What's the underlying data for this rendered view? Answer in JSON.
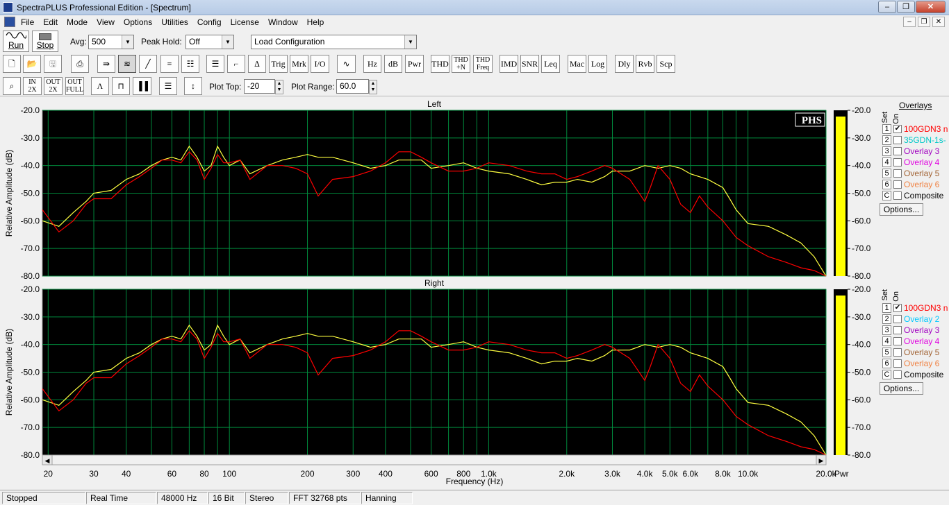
{
  "window": {
    "title": "SpectraPLUS Professional Edition - [Spectrum]"
  },
  "menu": [
    "File",
    "Edit",
    "Mode",
    "View",
    "Options",
    "Utilities",
    "Config",
    "License",
    "Window",
    "Help"
  ],
  "toolbar1": {
    "run_label": "Run",
    "stop_label": "Stop",
    "avg_label": "Avg:",
    "avg_value": "500",
    "peak_hold_label": "Peak Hold:",
    "peak_hold_value": "Off",
    "config_value": "Load Configuration"
  },
  "toolbar2": {
    "buttons": [
      "Trig",
      "Mrk",
      "I/O",
      "Hz",
      "dB",
      "Pwr",
      "THD",
      "THD +N",
      "THD Freq",
      "IMD",
      "SNR",
      "Leq",
      "Mac",
      "Log",
      "Dly",
      "Rvb",
      "Scp"
    ]
  },
  "toolbar3": {
    "zoom_in_label": "IN 2X",
    "zoom_out_label": "OUT 2X",
    "zoom_full_label": "OUT FULL",
    "plot_top_label": "Plot Top:",
    "plot_top_value": "-20",
    "plot_range_label": "Plot Range:",
    "plot_range_value": "60.0"
  },
  "plots": {
    "left_title": "Left",
    "right_title": "Right",
    "watermark": "PHS",
    "ylabel": "Relative Amplitude (dB)",
    "xlabel": "Frequency (Hz)",
    "meter_label": "Pwr"
  },
  "overlays": {
    "header": "Overlays",
    "set_label": "Set",
    "on_label": "On",
    "left": [
      {
        "set": "1",
        "name": "100GDN3 n",
        "checked": true,
        "color": "#ff0000"
      },
      {
        "set": "2",
        "name": "35GDN-1s-",
        "checked": false,
        "color": "#00c8c8"
      },
      {
        "set": "3",
        "name": "Overlay 3",
        "checked": false,
        "color": "#a000c0"
      },
      {
        "set": "4",
        "name": "Overlay 4",
        "checked": false,
        "color": "#e000e0"
      },
      {
        "set": "5",
        "name": "Overlay 5",
        "checked": false,
        "color": "#a06030"
      },
      {
        "set": "6",
        "name": "Overlay 6",
        "checked": false,
        "color": "#f08040"
      },
      {
        "set": "C",
        "name": "Composite",
        "checked": false,
        "color": "#000000"
      }
    ],
    "right": [
      {
        "set": "1",
        "name": "100GDN3 n",
        "checked": true,
        "color": "#ff0000"
      },
      {
        "set": "2",
        "name": "Overlay 2",
        "checked": false,
        "color": "#00c8ff"
      },
      {
        "set": "3",
        "name": "Overlay 3",
        "checked": false,
        "color": "#a000c0"
      },
      {
        "set": "4",
        "name": "Overlay 4",
        "checked": false,
        "color": "#e000e0"
      },
      {
        "set": "5",
        "name": "Overlay 5",
        "checked": false,
        "color": "#a06030"
      },
      {
        "set": "6",
        "name": "Overlay 6",
        "checked": false,
        "color": "#f08040"
      },
      {
        "set": "C",
        "name": "Composite",
        "checked": false,
        "color": "#000000"
      }
    ],
    "options_label": "Options..."
  },
  "status": [
    "Stopped",
    "Real Time",
    "48000 Hz",
    "16 Bit",
    "Stereo",
    "FFT 32768 pts",
    "Hanning"
  ],
  "chart_data": [
    {
      "type": "line",
      "title": "Left",
      "xlabel": "Frequency (Hz)",
      "ylabel": "Relative Amplitude (dB)",
      "xscale": "log",
      "xlim": [
        19,
        20000
      ],
      "ylim": [
        -80,
        -20
      ],
      "yticks": [
        "-20.0",
        "-30.0",
        "-40.0",
        "-50.0",
        "-60.0",
        "-70.0",
        "-80.0"
      ],
      "xticks": [
        {
          "v": 20,
          "t": "20"
        },
        {
          "v": 30,
          "t": "30"
        },
        {
          "v": 40,
          "t": "40"
        },
        {
          "v": 60,
          "t": "60"
        },
        {
          "v": 80,
          "t": "80"
        },
        {
          "v": 100,
          "t": "100"
        },
        {
          "v": 200,
          "t": "200"
        },
        {
          "v": 300,
          "t": "300"
        },
        {
          "v": 400,
          "t": "400"
        },
        {
          "v": 600,
          "t": "600"
        },
        {
          "v": 800,
          "t": "800"
        },
        {
          "v": 1000,
          "t": "1.0k"
        },
        {
          "v": 2000,
          "t": "2.0k"
        },
        {
          "v": 3000,
          "t": "3.0k"
        },
        {
          "v": 4000,
          "t": "4.0k"
        },
        {
          "v": 5000,
          "t": "5.0k"
        },
        {
          "v": 6000,
          "t": "6.0k"
        },
        {
          "v": 8000,
          "t": "8.0k"
        },
        {
          "v": 10000,
          "t": "10.0k"
        },
        {
          "v": 20000,
          "t": "20.0k"
        }
      ],
      "grid": true,
      "series": [
        {
          "color": "#ffff40",
          "x": [
            19,
            22,
            25,
            28,
            30,
            35,
            40,
            45,
            50,
            55,
            60,
            65,
            70,
            75,
            80,
            85,
            90,
            95,
            100,
            110,
            120,
            140,
            160,
            180,
            200,
            220,
            250,
            300,
            350,
            400,
            450,
            500,
            550,
            600,
            700,
            800,
            900,
            1000,
            1200,
            1400,
            1600,
            1800,
            2000,
            2200,
            2500,
            2800,
            3000,
            3500,
            4000,
            4500,
            5000,
            5500,
            6000,
            7000,
            8000,
            8500,
            9000,
            10000,
            12000,
            14000,
            16000,
            18000,
            20000
          ],
          "y": [
            -60,
            -62,
            -57,
            -53,
            -50,
            -49,
            -45,
            -43,
            -40,
            -38,
            -37,
            -38,
            -33,
            -37,
            -42,
            -40,
            -33,
            -37,
            -40,
            -38,
            -43,
            -40,
            -38,
            -37,
            -36,
            -37,
            -37,
            -39,
            -41,
            -40,
            -38,
            -38,
            -38,
            -41,
            -40,
            -39,
            -41,
            -42,
            -43,
            -45,
            -47,
            -46,
            -46,
            -45,
            -46,
            -44,
            -42,
            -42,
            -40,
            -41,
            -40,
            -41,
            -43,
            -45,
            -48,
            -52,
            -56,
            -61,
            -62,
            -65,
            -68,
            -73,
            -80
          ]
        },
        {
          "color": "#ff0000",
          "x": [
            19,
            22,
            25,
            28,
            30,
            35,
            40,
            45,
            50,
            55,
            60,
            65,
            70,
            75,
            80,
            85,
            90,
            95,
            100,
            110,
            120,
            140,
            160,
            180,
            200,
            220,
            250,
            300,
            350,
            400,
            450,
            500,
            550,
            600,
            700,
            800,
            900,
            1000,
            1200,
            1400,
            1600,
            1800,
            2000,
            2200,
            2500,
            2800,
            3000,
            3500,
            4000,
            4200,
            4500,
            5000,
            5500,
            6000,
            6500,
            7000,
            8000,
            9000,
            10000,
            12000,
            14000,
            16000,
            18000,
            20000
          ],
          "y": [
            -56,
            -64,
            -60,
            -54,
            -52,
            -52,
            -47,
            -44,
            -41,
            -38,
            -38,
            -39,
            -35,
            -38,
            -45,
            -41,
            -36,
            -39,
            -39,
            -38,
            -45,
            -40,
            -40,
            -41,
            -43,
            -51,
            -45,
            -44,
            -42,
            -39,
            -35,
            -35,
            -37,
            -39,
            -42,
            -42,
            -41,
            -39,
            -40,
            -42,
            -43,
            -43,
            -45,
            -44,
            -42,
            -40,
            -41,
            -45,
            -53,
            -48,
            -40,
            -45,
            -54,
            -57,
            -51,
            -55,
            -60,
            -66,
            -69,
            -73,
            -75,
            -77,
            -78,
            -80
          ]
        }
      ]
    },
    {
      "type": "line",
      "title": "Right",
      "xlabel": "Frequency (Hz)",
      "ylabel": "Relative Amplitude (dB)",
      "xscale": "log",
      "xlim": [
        19,
        20000
      ],
      "ylim": [
        -80,
        -20
      ],
      "yticks": [
        "-20.0",
        "-30.0",
        "-40.0",
        "-50.0",
        "-60.0",
        "-70.0",
        "-80.0"
      ],
      "xticks": [
        {
          "v": 20,
          "t": "20"
        },
        {
          "v": 30,
          "t": "30"
        },
        {
          "v": 40,
          "t": "40"
        },
        {
          "v": 60,
          "t": "60"
        },
        {
          "v": 80,
          "t": "80"
        },
        {
          "v": 100,
          "t": "100"
        },
        {
          "v": 200,
          "t": "200"
        },
        {
          "v": 300,
          "t": "300"
        },
        {
          "v": 400,
          "t": "400"
        },
        {
          "v": 600,
          "t": "600"
        },
        {
          "v": 800,
          "t": "800"
        },
        {
          "v": 1000,
          "t": "1.0k"
        },
        {
          "v": 2000,
          "t": "2.0k"
        },
        {
          "v": 3000,
          "t": "3.0k"
        },
        {
          "v": 4000,
          "t": "4.0k"
        },
        {
          "v": 5000,
          "t": "5.0k"
        },
        {
          "v": 6000,
          "t": "6.0k"
        },
        {
          "v": 8000,
          "t": "8.0k"
        },
        {
          "v": 10000,
          "t": "10.0k"
        },
        {
          "v": 20000,
          "t": "20.0k"
        }
      ],
      "grid": true,
      "series": [
        {
          "color": "#ffff40",
          "x": [
            19,
            22,
            25,
            28,
            30,
            35,
            40,
            45,
            50,
            55,
            60,
            65,
            70,
            75,
            80,
            85,
            90,
            95,
            100,
            110,
            120,
            140,
            160,
            180,
            200,
            220,
            250,
            300,
            350,
            400,
            450,
            500,
            550,
            600,
            700,
            800,
            900,
            1000,
            1200,
            1400,
            1600,
            1800,
            2000,
            2200,
            2500,
            2800,
            3000,
            3500,
            4000,
            4500,
            5000,
            5500,
            6000,
            7000,
            8000,
            8500,
            9000,
            10000,
            12000,
            14000,
            16000,
            18000,
            20000
          ],
          "y": [
            -60,
            -62,
            -57,
            -53,
            -50,
            -49,
            -45,
            -43,
            -40,
            -38,
            -37,
            -38,
            -33,
            -37,
            -42,
            -40,
            -33,
            -37,
            -40,
            -38,
            -43,
            -40,
            -38,
            -37,
            -36,
            -37,
            -37,
            -39,
            -41,
            -40,
            -38,
            -38,
            -38,
            -41,
            -40,
            -39,
            -41,
            -42,
            -43,
            -45,
            -47,
            -46,
            -46,
            -45,
            -46,
            -44,
            -42,
            -42,
            -40,
            -41,
            -40,
            -41,
            -43,
            -45,
            -48,
            -52,
            -56,
            -61,
            -62,
            -65,
            -68,
            -73,
            -80
          ]
        },
        {
          "color": "#ff0000",
          "x": [
            19,
            22,
            25,
            28,
            30,
            35,
            40,
            45,
            50,
            55,
            60,
            65,
            70,
            75,
            80,
            85,
            90,
            95,
            100,
            110,
            120,
            140,
            160,
            180,
            200,
            220,
            250,
            300,
            350,
            400,
            450,
            500,
            550,
            600,
            700,
            800,
            900,
            1000,
            1200,
            1400,
            1600,
            1800,
            2000,
            2200,
            2500,
            2800,
            3000,
            3500,
            4000,
            4200,
            4500,
            5000,
            5500,
            6000,
            6500,
            7000,
            8000,
            9000,
            10000,
            12000,
            14000,
            16000,
            18000,
            20000
          ],
          "y": [
            -56,
            -64,
            -60,
            -54,
            -52,
            -52,
            -47,
            -44,
            -41,
            -38,
            -38,
            -39,
            -35,
            -38,
            -45,
            -41,
            -36,
            -39,
            -39,
            -38,
            -45,
            -40,
            -40,
            -41,
            -43,
            -51,
            -45,
            -44,
            -42,
            -39,
            -35,
            -35,
            -37,
            -39,
            -42,
            -42,
            -41,
            -39,
            -40,
            -42,
            -43,
            -43,
            -45,
            -44,
            -42,
            -40,
            -41,
            -45,
            -53,
            -48,
            -40,
            -45,
            -54,
            -57,
            -51,
            -55,
            -60,
            -66,
            -69,
            -73,
            -75,
            -77,
            -78,
            -80
          ]
        }
      ]
    }
  ]
}
